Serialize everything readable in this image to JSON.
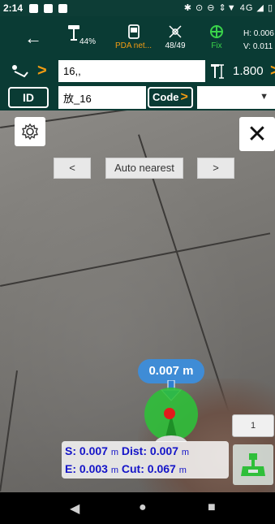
{
  "status_bar": {
    "time": "2:14",
    "indicators": "✱ ⊙ ⊖ ⇕▼ 4G ◢ ▯"
  },
  "top_bar": {
    "antenna_battery": "44%",
    "pda_label": "PDA net...",
    "satellites": "48/49",
    "fix_label": "Fix",
    "h_precision": "H: 0.006",
    "v_precision": "V: 0.011"
  },
  "point_row": {
    "point_value": "16,,",
    "height_value": "1.800"
  },
  "id_row": {
    "id_label": "ID",
    "id_value": "放_16",
    "code_label": "Code",
    "code_value": ""
  },
  "camera": {
    "prev_label": "<",
    "mode_label": "Auto nearest",
    "next_label": ">",
    "distance_bubble": "0.007 m",
    "point_count": "1",
    "readout": {
      "s_label": "S:",
      "s_value": "0.007",
      "s_unit": "m",
      "dist_label": "Dist:",
      "dist_value": "0.007",
      "dist_unit": "m",
      "e_label": "E:",
      "e_value": "0.003",
      "e_unit": "m",
      "cut_label": "Cut:",
      "cut_value": "0.067",
      "cut_unit": "m"
    }
  },
  "nav_bar": {
    "back": "◀",
    "home": "●",
    "recents": "■"
  },
  "colors": {
    "header_bg": "#0a3b34",
    "accent_orange": "#f39c12",
    "fix_green": "#3ad34a",
    "readout_blue": "#1414c8",
    "bubble_blue": "#3f8cd6"
  }
}
